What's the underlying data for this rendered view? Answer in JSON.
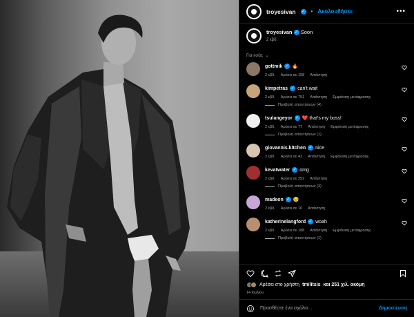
{
  "post": {
    "author": "troyesivan",
    "follow_label": "Ακολουθήστε",
    "caption_text": "Soon",
    "caption_time": "2 εβδ.",
    "for_you": "Για εσάς"
  },
  "comments": [
    {
      "user": "gottmik",
      "text": "🔥",
      "time": "2 εβδ.",
      "likes": "Αρέσει σε 158",
      "reply": "Απάντηση",
      "translate": "",
      "replies": "",
      "avatar_color": "#8a7766"
    },
    {
      "user": "kimpetras",
      "text": "can't wait",
      "time": "2 εβδ.",
      "likes": "Αρέσει σε 751",
      "reply": "Απάντηση",
      "translate": "Εμφάνιση μετάφρασης",
      "replies": "Προβολή απαντήσεων (4)",
      "avatar_color": "#c9a37a"
    },
    {
      "user": "tsulangeyor",
      "text": "❤️ that's my boss!",
      "time": "2 εβδ.",
      "likes": "Αρέσει σε 77",
      "reply": "Απάντηση",
      "translate": "Εμφάνιση μετάφρασης",
      "replies": "Προβολή απαντήσεων (1)",
      "avatar_color": "#f0f0f0"
    },
    {
      "user": "giovannis.kitchen",
      "text": "nice",
      "time": "2 εβδ.",
      "likes": "Αρέσει σε 42",
      "reply": "Απάντηση",
      "translate": "Εμφάνιση μετάφρασης",
      "replies": "",
      "avatar_color": "#d8c6b0"
    },
    {
      "user": "kevatwater",
      "text": "omg",
      "time": "2 εβδ.",
      "likes": "Αρέσει σε 252",
      "reply": "Απάντηση",
      "translate": "",
      "replies": "Προβολή απαντήσεων (3)",
      "avatar_color": "#a03030"
    },
    {
      "user": "madeon",
      "text": "🥺",
      "time": "2 εβδ.",
      "likes": "Αρέσει σε 10",
      "reply": "Απάντηση",
      "translate": "",
      "replies": "",
      "avatar_color": "#c7a7d6"
    },
    {
      "user": "katherinelangford",
      "text": "woah",
      "time": "2 εβδ.",
      "likes": "Αρέσει σε 188",
      "reply": "Απάντηση",
      "translate": "Εμφάνιση μετάφρασης",
      "replies": "Προβολή απαντήσεων (1)",
      "avatar_color": "#b89070"
    }
  ],
  "likes_line": {
    "prefix": "Αρέσει στο χρήστη",
    "user": "tmilitsis",
    "suffix": "και 251 χιλ. ακόμη"
  },
  "date": "14 Ιουλίου",
  "add_comment": {
    "placeholder": "Προσθέστε ένα σχόλιο...",
    "post_label": "Δημοσίευση"
  },
  "icons": [
    "heart-icon",
    "comment-icon",
    "share-icon",
    "send-icon",
    "bookmark-icon",
    "emoji-icon",
    "more-icon"
  ]
}
